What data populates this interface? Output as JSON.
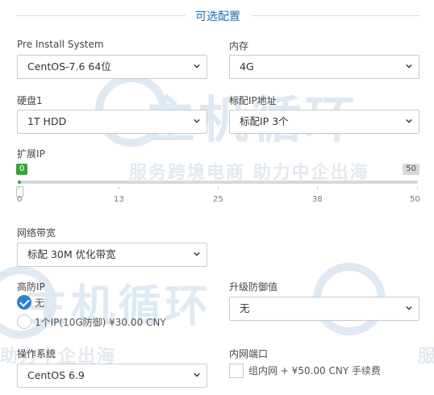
{
  "section": {
    "title": "可选配置"
  },
  "fields": {
    "pre_install": {
      "label": "Pre Install System",
      "value": "CentOS-7.6 64位"
    },
    "memory": {
      "label": "内存",
      "value": "4G"
    },
    "disk": {
      "label": "硬盘1",
      "value": "1T HDD"
    },
    "std_ip": {
      "label": "标配IP地址",
      "value": "标配IP 3个"
    },
    "ext_ip": {
      "label": "扩展IP",
      "current": "0",
      "current_value": 0,
      "max": "50",
      "ticks": [
        "0",
        "13",
        "25",
        "38",
        "50"
      ]
    },
    "bandwidth": {
      "label": "网络带宽",
      "value": "标配 30M 优化带宽"
    },
    "ddos_ip": {
      "label": "高防IP",
      "options": [
        {
          "label": "无",
          "checked": true
        },
        {
          "label": "1个IP(10G防御) ¥30.00 CNY",
          "checked": false
        }
      ]
    },
    "ddos_upgrade": {
      "label": "升级防御值",
      "value": "无"
    },
    "os": {
      "label": "操作系统",
      "value": "CentOS 6.9"
    },
    "lan_port": {
      "label": "内网端口",
      "option": "组内网 + ¥50.00 CNY 手续费",
      "checked": false
    }
  },
  "watermark": {
    "logo": "主机循环",
    "slogan": "服务跨境电商 助力中企出海",
    "slogan_left": "助力中企出海",
    "slogan_right": "服"
  },
  "colors": {
    "accent": "#1b6fb5",
    "slider_fill": "#39a339",
    "radio_checked": "#2e7fd6",
    "badge_min_bg": "#39a339",
    "badge_max_bg": "#d9d9d9"
  }
}
